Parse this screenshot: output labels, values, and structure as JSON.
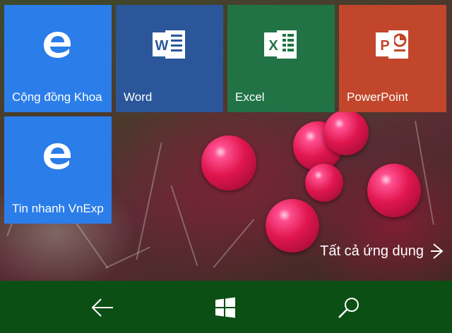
{
  "tiles": [
    {
      "label": "Cộng đồng Khoa",
      "icon": "edge-icon",
      "color": "#2b7de9"
    },
    {
      "label": "Word",
      "icon": "word-icon",
      "color": "#2b579a"
    },
    {
      "label": "Excel",
      "icon": "excel-icon",
      "color": "#217346"
    },
    {
      "label": "PowerPoint",
      "icon": "powerpoint-icon",
      "color": "#c2462b"
    },
    {
      "label": "Tin nhanh VnExp",
      "icon": "edge-icon",
      "color": "#2b7de9"
    }
  ],
  "all_apps": {
    "label": "Tất cả ứng dụng",
    "icon": "chevron-right-icon"
  },
  "navbar": {
    "color": "#0c4f14",
    "buttons": [
      {
        "icon": "back-arrow-icon"
      },
      {
        "icon": "windows-start-icon"
      },
      {
        "icon": "search-icon"
      }
    ]
  }
}
